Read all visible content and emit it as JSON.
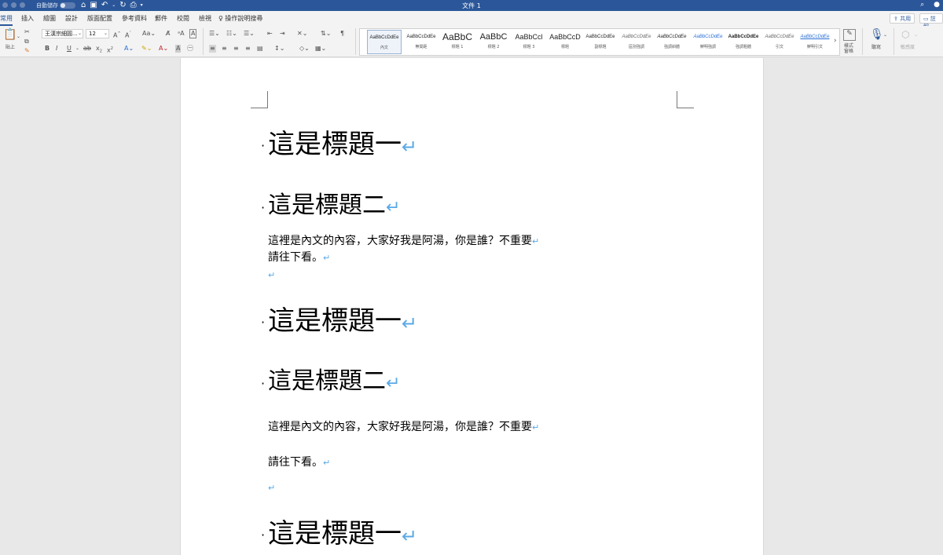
{
  "titlebar": {
    "autosave_label": "自動儲存",
    "toggle_state": "關閉",
    "title": "文件 1"
  },
  "tabs": [
    "常用",
    "插入",
    "繪圖",
    "設計",
    "版面配置",
    "參考資料",
    "郵件",
    "校閱",
    "檢視"
  ],
  "active_tab": "常用",
  "tell_me": "操作說明搜尋",
  "share_label": "共用",
  "comments_label": "註解",
  "ribbon": {
    "paste_label": "貼上",
    "font_name": "王漢宗細圓...",
    "font_size": "12",
    "styles": [
      {
        "sample": "AaBbCcDdEe",
        "label": "內文"
      },
      {
        "sample": "AaBbCcDdEe",
        "label": "無間距"
      },
      {
        "sample": "AaBbC",
        "label": "標題 1"
      },
      {
        "sample": "AaBbC",
        "label": "標題 2"
      },
      {
        "sample": "AaBbCcl",
        "label": "標題 3"
      },
      {
        "sample": "AaBbCcD",
        "label": "標題"
      },
      {
        "sample": "AaBbCcDdEe",
        "label": "副標題"
      },
      {
        "sample": "AaBbCcDdEe",
        "label": "區別強調"
      },
      {
        "sample": "AaBbCcDdEe",
        "label": "強調斜體"
      },
      {
        "sample": "AaBbCcDdEe",
        "label": "鮮明強調"
      },
      {
        "sample": "AaBbCcDdEe",
        "label": "強調粗體"
      },
      {
        "sample": "AaBbCcDdEe",
        "label": "引文"
      },
      {
        "sample": "AaBbCcDdEe",
        "label": "鮮明引文"
      }
    ],
    "style_pane_label": "樣式\n窗格",
    "dictate_label": "聽寫",
    "sensitivity_label": "敏感度"
  },
  "document": {
    "heading1": "這是標題一",
    "heading2": "這是標題二",
    "para1_line1": "這裡是內文的內容，大家好我是阿湯，你是誰？不重要",
    "para1_line2": "請往下看。",
    "para2_line1": "這裡是內文的內容，大家好我是阿湯，你是誰？不重要",
    "para2_line2": "請往下看。",
    "paragraph_mark": "↵",
    "bullet": "·"
  }
}
